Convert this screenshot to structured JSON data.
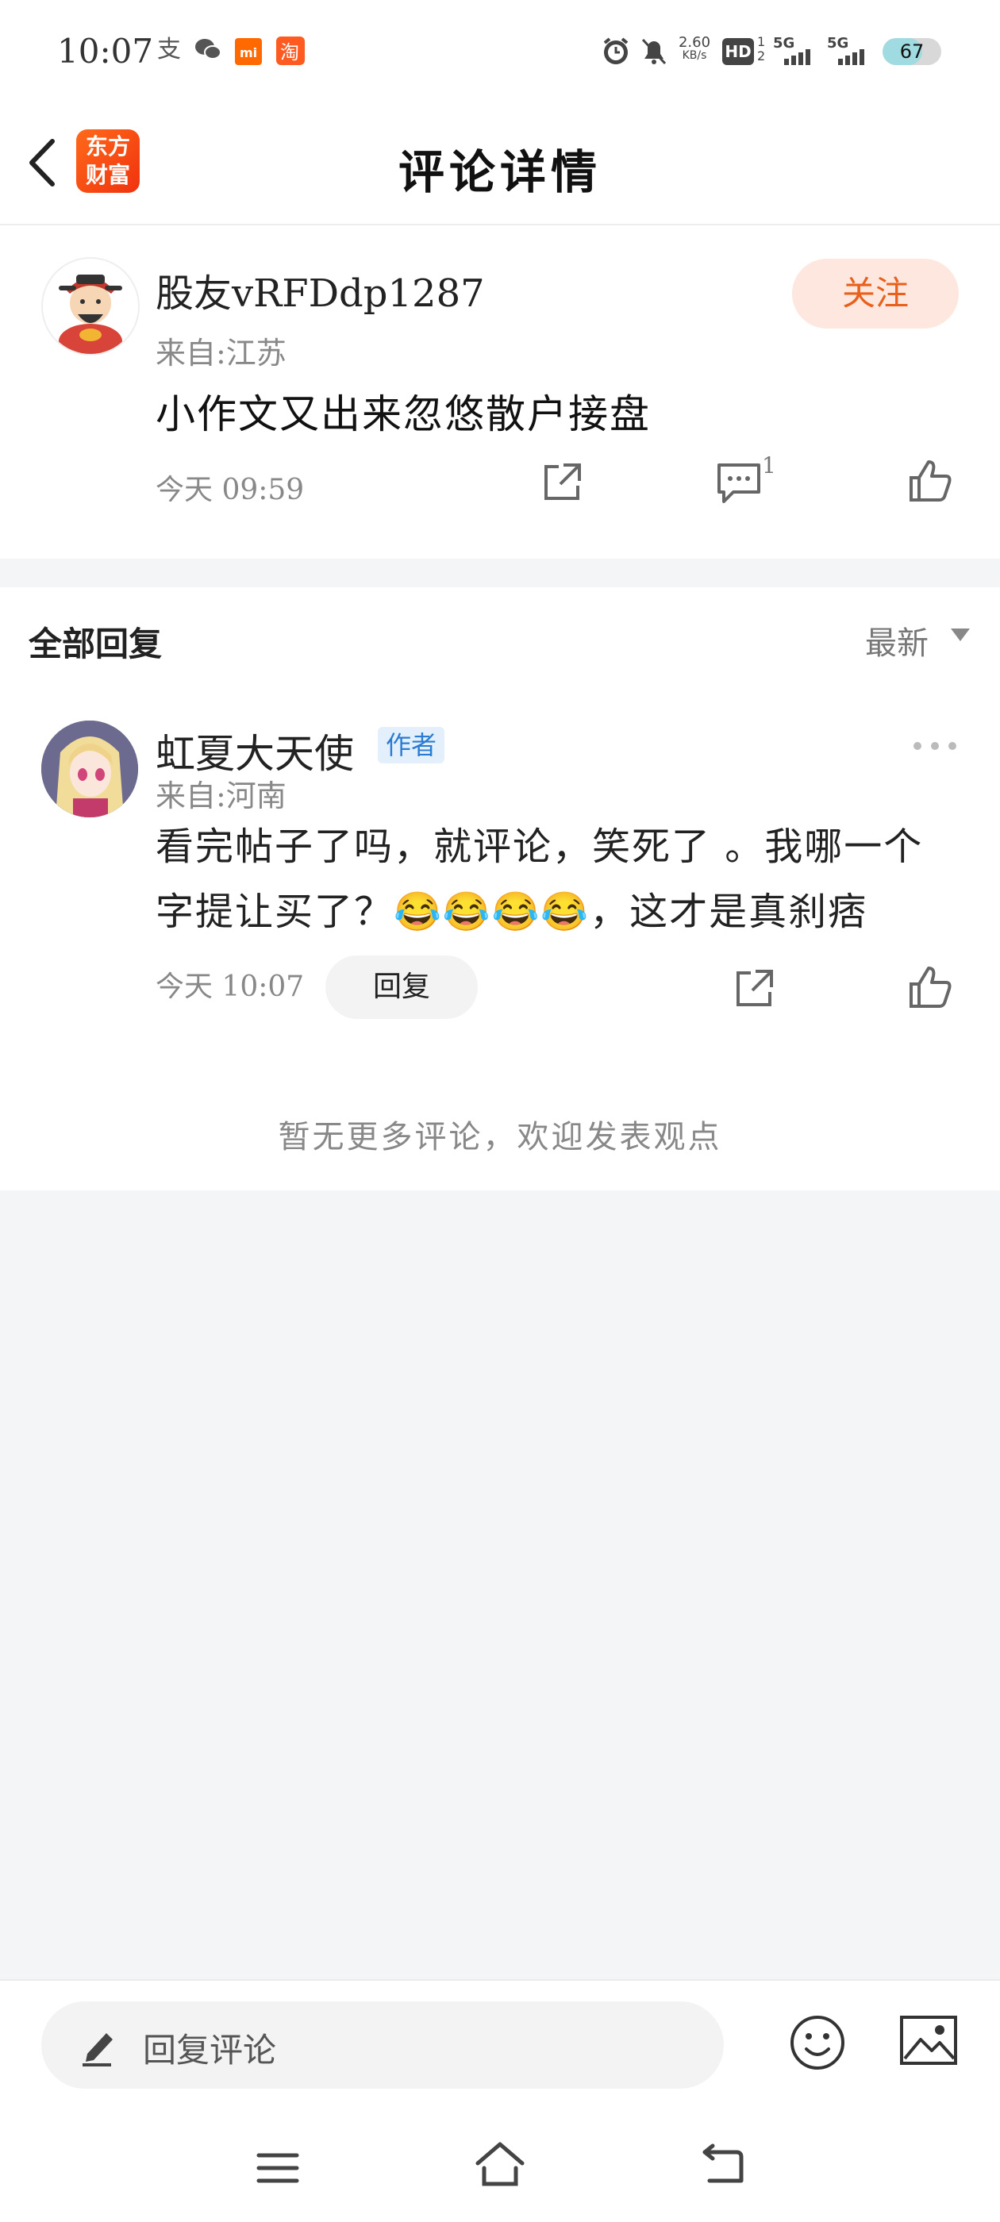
{
  "status_bar": {
    "time": "10:07",
    "speed_value": "2.60",
    "speed_unit": "KB/s",
    "hd_label": "HD",
    "network_1": "5G",
    "network_2": "5G",
    "battery_level": "67",
    "battery_fraction": 0.67,
    "left_icons": [
      "alipay-icon",
      "wechat-icon",
      "mi-icon",
      "taobao-icon"
    ],
    "right_icons": [
      "alarm-icon",
      "mute-icon",
      "signal-icon",
      "battery-icon"
    ]
  },
  "header": {
    "title": "评论详情",
    "logo_line1": "东方",
    "logo_line2": "财富"
  },
  "main_comment": {
    "username": "股友vRFDdp1287",
    "follow_label": "关注",
    "location": "来自:江苏",
    "content": "小作文又出来忽悠散户接盘",
    "time": "今天 09:59",
    "comment_count": "1"
  },
  "replies_section": {
    "title": "全部回复",
    "sort_label": "最新"
  },
  "reply": {
    "username": "虹夏大天使",
    "badge": "作者",
    "location": "来自:河南",
    "text": "看完帖子了吗，就评论，笑死了 。我哪一个字提让买了？😂😂😂😂，这才是真刹痞",
    "time": "今天 10:07",
    "reply_button": "回复"
  },
  "no_more_text": "暂无更多评论，欢迎发表观点",
  "bottom_bar": {
    "input_placeholder": "回复评论"
  },
  "colors": {
    "accent": "#e8601c",
    "follow_bg": "#fde7de",
    "badge_text": "#2b7bd2",
    "badge_bg": "#e3f0fb",
    "page_bg": "#f4f5f7"
  }
}
